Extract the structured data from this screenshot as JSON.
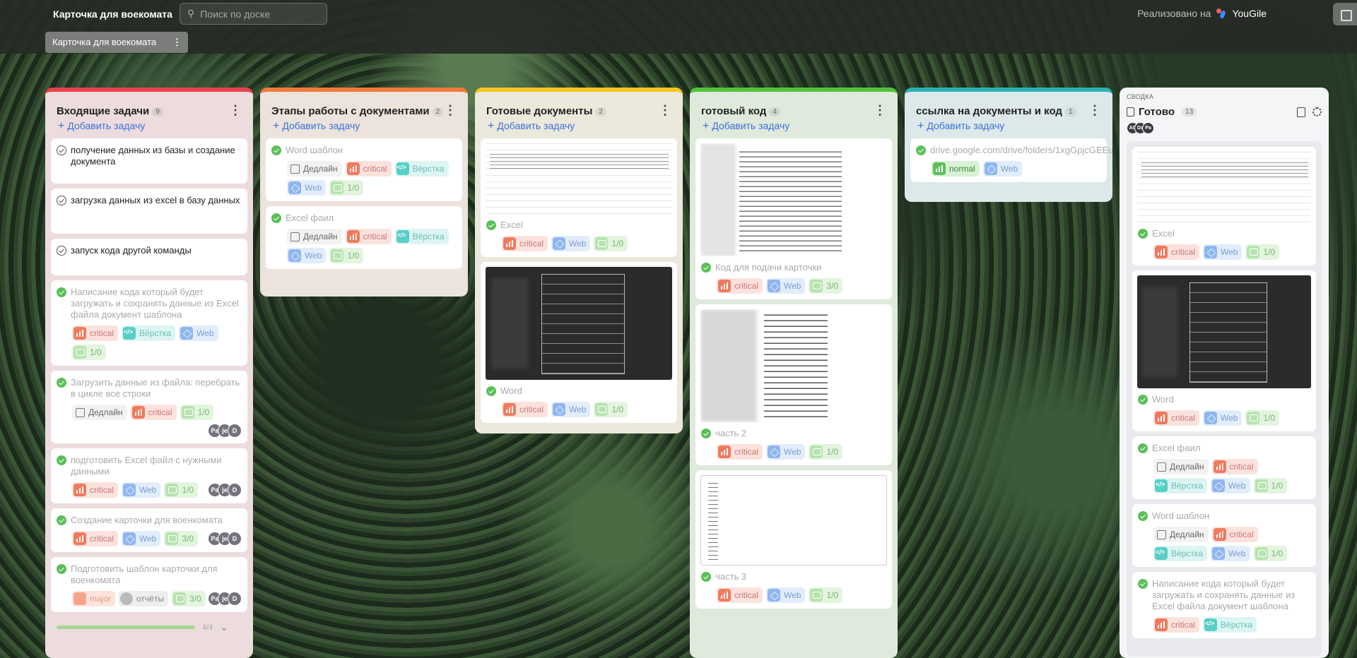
{
  "header": {
    "app_title": "Карточка для воекомата",
    "search_placeholder": "Поиск по доске",
    "brand_prefix": "Реализовано на",
    "brand_name": "YouGile"
  },
  "tab": {
    "label": "Карточка для воекомата"
  },
  "columns": [
    {
      "title": "Входящие задачи",
      "count": "9",
      "color": "#e8414b",
      "bg": "#ecdcdd",
      "add": "Добавить задачу",
      "cards": [
        {
          "title": "получение данных из базы и создание документа"
        },
        {
          "title": "загрузка данных из excel в базу данных"
        },
        {
          "title": "запуск кода другой команды"
        },
        {
          "title": "Написание кода который будет загружать и сохранять данные из Excel файла документ шаблона",
          "tags": [
            "critical",
            "Вёрстка",
            "Web",
            "1/0"
          ]
        },
        {
          "title": "Загрузить данные из файла: перебрать в цикле все строки",
          "tags": [
            "Дедлайн",
            "critical",
            "1/0"
          ],
          "avatars": [
            "Pa",
            "je",
            "D"
          ]
        },
        {
          "title": "подготовить Excel файл с нужными данными",
          "tags": [
            "critical",
            "Web",
            "1/0"
          ],
          "avatars": [
            "Pa",
            "je",
            "D"
          ]
        },
        {
          "title": "Создание карточки для военкомата",
          "tags": [
            "critical",
            "Web",
            "3/0"
          ],
          "avatars": [
            "Pa",
            "je",
            "D"
          ]
        },
        {
          "title": "Подготовить шаблон карточки для военкомата",
          "tags": [
            "major",
            "отчёты",
            "3/0"
          ],
          "avatars": [
            "Pa",
            "je",
            "D"
          ]
        }
      ],
      "progress": "4/4"
    },
    {
      "title": "Этапы работы с документами",
      "count": "2",
      "color": "#f07a3c",
      "bg": "#ece3dc",
      "add": "Добавить задачу",
      "cards": [
        {
          "title": "Word шаблон",
          "tags": [
            "Дедлайн",
            "critical",
            "Вёрстка",
            "Web",
            "1/0"
          ]
        },
        {
          "title": "Excel фаил",
          "tags": [
            "Дедлайн",
            "critical",
            "Вёрстка",
            "Web",
            "1/0"
          ]
        }
      ]
    },
    {
      "title": "Готовые документы",
      "count": "2",
      "color": "#f4c61d",
      "bg": "#ebe8dc",
      "add": "Добавить задачу",
      "cards": [
        {
          "title": "Excel",
          "tags": [
            "critical",
            "Web",
            "1/0"
          ]
        },
        {
          "title": "Word",
          "tags": [
            "critical",
            "Web",
            "1/0"
          ]
        }
      ]
    },
    {
      "title": "готовый код",
      "count": "4",
      "color": "#53c23a",
      "bg": "#dfe9dc",
      "add": "Добавить задачу",
      "cards": [
        {
          "title": "Код для подачи карточки",
          "tags": [
            "critical",
            "Web",
            "3/0"
          ]
        },
        {
          "title": "часть 2",
          "tags": [
            "critical",
            "Web",
            "1/0"
          ]
        },
        {
          "title": "часть 3",
          "tags": [
            "critical",
            "Web",
            "1/0"
          ]
        }
      ]
    },
    {
      "title": "ссылка на документы и код",
      "count": "1",
      "color": "#2bb0b5",
      "bg": "#dce8e9",
      "add": "Добавить задачу",
      "cards": [
        {
          "title": "drive.google.com/drive/folders/1xgGpjcGEEu...",
          "tags": [
            "normal",
            "Web"
          ]
        }
      ]
    }
  ],
  "summary": {
    "label": "СВОДКА",
    "title": "Готово",
    "count": "13",
    "avatars": [
      "AC",
      "Da",
      "Pa"
    ],
    "cards": [
      {
        "title": "Excel",
        "tags": [
          "critical",
          "Web",
          "1/0"
        ]
      },
      {
        "title": "Word",
        "tags": [
          "critical",
          "Web",
          "1/0"
        ]
      },
      {
        "title": "Excel фаил",
        "tags": [
          "Дедлайн",
          "critical",
          "Вёрстка",
          "Web",
          "1/0"
        ]
      },
      {
        "title": "Word шаблон",
        "tags": [
          "Дедлайн",
          "critical",
          "Вёрстка",
          "Web",
          "1/0"
        ]
      },
      {
        "title": "Написание кода который будет загружать и сохранять данные из Excel файла документ шаблона",
        "tags": [
          "critical",
          "Вёрстка"
        ]
      }
    ]
  },
  "icons": {
    "search": "search-icon",
    "dots": "more-icon",
    "check": "check-icon",
    "deadline": "calendar-icon",
    "priority": "bar-chart-icon",
    "web": "cube-icon",
    "layout": "code-icon",
    "comments": "comment-icon",
    "link": "external-link-icon",
    "settings": "gear-icon",
    "document": "document-icon"
  }
}
